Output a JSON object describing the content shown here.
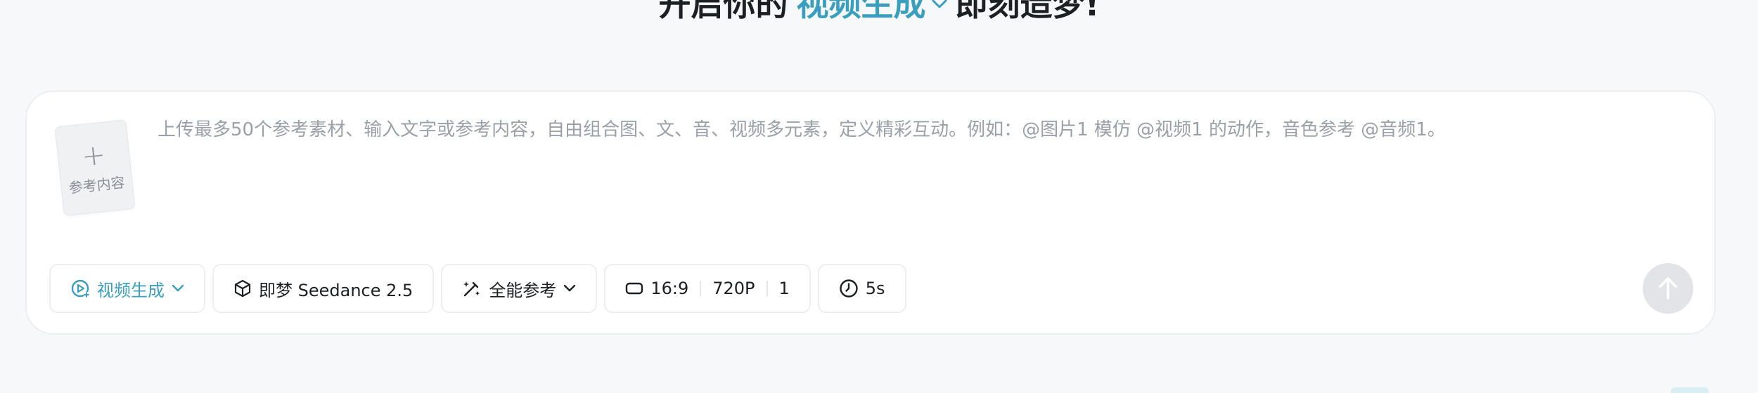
{
  "hero": {
    "prefix": "开启你的",
    "mode": "视频生成",
    "suffix": "即刻造梦!"
  },
  "composer": {
    "reference_upload_label": "参考内容",
    "prompt_placeholder": "上传最多50个参考素材、输入文字或参考内容，自由组合图、文、音、视频多元素，定义精彩互动。例如：@图片1 模仿 @视频1 的动作，音色参考 @音频1。",
    "prompt_value": ""
  },
  "toolbar": {
    "mode_label": "视频生成",
    "model_label": "即梦 Seedance 2.5",
    "reference_mode_label": "全能参考",
    "aspect_ratio": "16:9",
    "resolution": "720P",
    "count": "1",
    "duration": "5s"
  },
  "colors": {
    "accent": "#3a9fbf",
    "send_disabled": "#e3e4e7"
  },
  "icons": {
    "mode": "video-spark-icon",
    "model": "cube-icon",
    "reference": "magic-wand-icon",
    "aspect": "aspect-ratio-icon",
    "duration": "clock-icon",
    "send": "arrow-up-icon"
  }
}
